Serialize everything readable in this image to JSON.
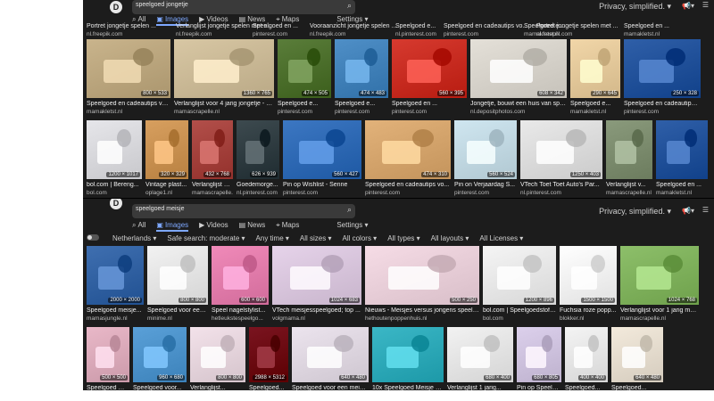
{
  "top": {
    "query": "speelgoed jongetje",
    "privacy": "Privacy, simplified.",
    "tabs": [
      {
        "label": "All",
        "glyph": "⌕",
        "active": false
      },
      {
        "label": "Images",
        "glyph": "▣",
        "active": true
      },
      {
        "label": "Videos",
        "glyph": "▶",
        "active": false
      },
      {
        "label": "News",
        "glyph": "▤",
        "active": false
      },
      {
        "label": "Maps",
        "glyph": "⌖",
        "active": false
      },
      {
        "label": "Settings ▾",
        "glyph": "",
        "active": false
      }
    ],
    "prev_row_titles": [
      "Portret jongetje spelen ...",
      "Verlanglijst jongetje spelen met s...",
      "Speelgoed en ...",
      "Vooraanzicht jongetje spelen ...",
      "Speelgoed e...",
      "Speelgoed en cadeautips vo...",
      "Speelgoed e...",
      "Portret jongetje spelen met ...",
      "Speelgoed en ..."
    ],
    "prev_row_sources": [
      "nl.freepik.com",
      "nl.freepik.com",
      "pinterest.com",
      "nl.freepik.com",
      "nl.pinterest.com",
      "pinterest.com",
      "mamakletst.nl",
      "nl.freepik.com",
      "mamakletst.nl"
    ],
    "row1": [
      {
        "title": "Speelgoed en cadeautips vo...",
        "source": "mamakletst.nl",
        "dim": "800 × 533",
        "color": "#c9b48c"
      },
      {
        "title": "Verlanglijst voor 4 jarig jongetje - e...",
        "source": "mamascrapelle.nl",
        "dim": "1360 × 765",
        "color": "#d8c7a4"
      },
      {
        "title": "Speelgoed e...",
        "source": "pinterest.com",
        "dim": "474 × 505",
        "color": "#5a7d3a"
      },
      {
        "title": "Speelgoed e...",
        "source": "pinterest.com",
        "dim": "474 × 483",
        "color": "#4f8fc7"
      },
      {
        "title": "Speelgoed en ...",
        "source": "pinterest.com",
        "dim": "560 × 395",
        "color": "#d63a2f"
      },
      {
        "title": "Jongetje, bouwt een huis van speel...",
        "source": "nl.depositphotos.com",
        "dim": "608 × 342",
        "color": "#e4e0d8"
      },
      {
        "title": "Speelgoed e...",
        "source": "mamakletst.nl",
        "dim": "290 × 645",
        "color": "#f1d6a8"
      },
      {
        "title": "Speelgoed en cadeautips vo...",
        "source": "pinterest.com",
        "dim": "250 × 328",
        "color": "#2f5fa8"
      }
    ],
    "row2": [
      {
        "title": "bol.com | Bereng...",
        "source": "bol.com",
        "dim": "1200 × 1017",
        "color": "#e6e6ea"
      },
      {
        "title": "Vintage plast...",
        "source": "oplage1.nl",
        "dim": "320 × 329",
        "color": "#d79f5f"
      },
      {
        "title": "Verlanglijst vo...",
        "source": "mamascrapelle.nl",
        "dim": "432 × 768",
        "color": "#b24f4a"
      },
      {
        "title": "Goedemorge...",
        "source": "nl.pinterest.com",
        "dim": "626 × 939",
        "color": "#3d4a4f"
      },
      {
        "title": "Pin op Wishlist - Senne",
        "source": "pinterest.com",
        "dim": "560 × 427",
        "color": "#3c77c2"
      },
      {
        "title": "Speelgoed en cadeautips vo...",
        "source": "pinterest.com",
        "dim": "474 × 310",
        "color": "#e2b27a"
      },
      {
        "title": "Pin on Verjaardag S...",
        "source": "pinterest.com",
        "dim": "560 × 524",
        "color": "#cfe6f0"
      },
      {
        "title": "VTech Toet Toet Auto's Par...",
        "source": "nl.pinterest.com",
        "dim": "1250 × 403",
        "color": "#e9e9e9"
      },
      {
        "title": "Verlanglijst v...",
        "source": "mamascrapelle.nl",
        "dim": "",
        "color": "#8a9a7c"
      },
      {
        "title": "Speelgoed en ...",
        "source": "mamakletst.nl",
        "dim": "",
        "color": "#2f5fa8"
      }
    ]
  },
  "bottom": {
    "query": "speelgoed meisje",
    "privacy": "Privacy, simplified.",
    "tabs": [
      {
        "label": "All",
        "glyph": "⌕",
        "active": false
      },
      {
        "label": "Images",
        "glyph": "▣",
        "active": true
      },
      {
        "label": "Videos",
        "glyph": "▶",
        "active": false
      },
      {
        "label": "News",
        "glyph": "▤",
        "active": false
      },
      {
        "label": "Maps",
        "glyph": "⌖",
        "active": false
      },
      {
        "label": "Settings ▾",
        "glyph": "",
        "active": false
      }
    ],
    "filters": [
      "Netherlands ▾",
      "Safe search: moderate ▾",
      "Any time ▾",
      "All sizes ▾",
      "All colors ▾",
      "All types ▾",
      "All layouts ▾",
      "All Licenses ▾"
    ],
    "row1": [
      {
        "title": "Speelgoed meisje...",
        "source": "mamasjungle.nl",
        "dim": "2000 × 2000",
        "color": "#3f6fb0"
      },
      {
        "title": "Speelgoed voor een...",
        "source": "minime.nl",
        "dim": "800 × 800",
        "color": "#f2f2f2"
      },
      {
        "title": "Speel nagelstylist...",
        "source": "hetleukstespeelgo...",
        "dim": "600 × 600",
        "color": "#f08ab9"
      },
      {
        "title": "VTech meisjesspeelgoed; top ...",
        "source": "volgmama.nl",
        "dim": "1024 × 683",
        "color": "#e6d3ea"
      },
      {
        "title": "Nieuws - Meisjes versus jongens speelgo...",
        "source": "hethoutenpoppenhuis.nl",
        "dim": "500 × 250",
        "color": "#f6dce6"
      },
      {
        "title": "bol.com | Speelgoedstofzu...",
        "source": "bol.com",
        "dim": "1200 × 896",
        "color": "#f5f5f5"
      },
      {
        "title": "Fuchsia roze popp...",
        "source": "blokker.nl",
        "dim": "1500 × 1500",
        "color": "#ffffff"
      },
      {
        "title": "Verlanglijst voor 1 jarig meisje ...",
        "source": "mamascrapelle.nl",
        "dim": "1024 × 768",
        "color": "#8dbf6a"
      }
    ],
    "row2": [
      {
        "title": "Speelgoed me...",
        "source": "",
        "dim": "500 × 500",
        "color": "#e9b8c8"
      },
      {
        "title": "Speelgoed voor...",
        "source": "",
        "dim": "960 × 680",
        "color": "#5aa0d8"
      },
      {
        "title": "Verlanglijst...",
        "source": "",
        "dim": "800 × 800",
        "color": "#f3e2ea"
      },
      {
        "title": "Speelgoed...",
        "source": "",
        "dim": "2988 × 5312",
        "color": "#7a1420"
      },
      {
        "title": "Speelgoed voor een meisje...",
        "source": "",
        "dim": "640 × 480",
        "color": "#ece4ee"
      },
      {
        "title": "10x Speelgoed Meisje 3...",
        "source": "",
        "dim": "",
        "color": "#3bb7c6"
      },
      {
        "title": "Verlanglijst 1 jarig...",
        "source": "",
        "dim": "680 × 400",
        "color": "#f2f2f2"
      },
      {
        "title": "Pin op Speelgoed...",
        "source": "",
        "dim": "680 × 805",
        "color": "#dcd0ec"
      },
      {
        "title": "Speelgoed...",
        "source": "",
        "dim": "400 × 400",
        "color": "#f4f4f4"
      },
      {
        "title": "Speelgoed...",
        "source": "",
        "dim": "640 × 480",
        "color": "#f3eadc"
      }
    ]
  }
}
